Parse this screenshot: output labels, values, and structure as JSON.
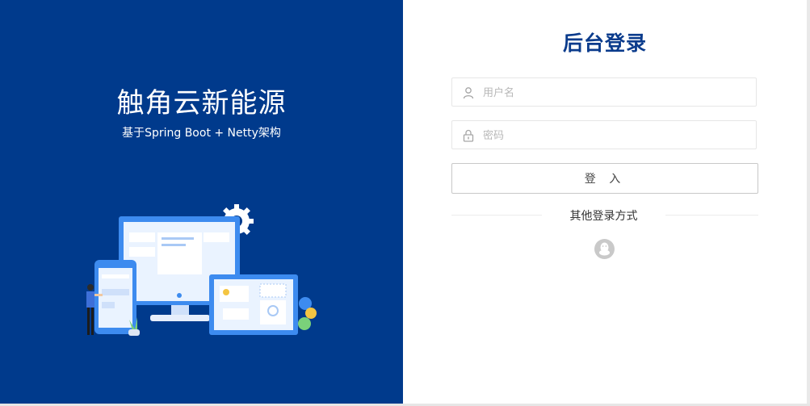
{
  "brand": {
    "title": "触角云新能源",
    "subtitle": "基于Spring Boot + Netty架构"
  },
  "login": {
    "title": "后台登录",
    "username_placeholder": "用户名",
    "password_placeholder": "密码",
    "submit_label": "登 入",
    "other_methods_label": "其他登录方式",
    "other_methods": [
      {
        "icon": "qq-icon"
      }
    ]
  },
  "colors": {
    "left_panel": "#003a8c",
    "title_blue": "#0a3b8c",
    "accent_light": "#3d8bef"
  }
}
